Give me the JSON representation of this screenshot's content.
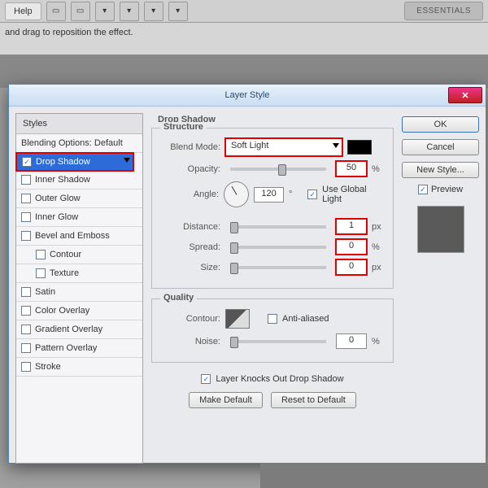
{
  "menubar": {
    "help": "Help"
  },
  "toolbar": {
    "essentials": "ESSENTIALS"
  },
  "optionsbar": {
    "hint": "and drag to reposition the effect."
  },
  "dialog": {
    "title": "Layer Style",
    "styles_header": "Styles",
    "styles": {
      "blending": "Blending Options: Default",
      "drop_shadow": "Drop Shadow",
      "inner_shadow": "Inner Shadow",
      "outer_glow": "Outer Glow",
      "inner_glow": "Inner Glow",
      "bevel": "Bevel and Emboss",
      "contour": "Contour",
      "texture": "Texture",
      "satin": "Satin",
      "color_overlay": "Color Overlay",
      "gradient_overlay": "Gradient Overlay",
      "pattern_overlay": "Pattern Overlay",
      "stroke": "Stroke"
    },
    "panel_title": "Drop Shadow",
    "structure_title": "Structure",
    "quality_title": "Quality",
    "labels": {
      "blend_mode": "Blend Mode:",
      "opacity": "Opacity:",
      "angle": "Angle:",
      "distance": "Distance:",
      "spread": "Spread:",
      "size": "Size:",
      "contour": "Contour:",
      "noise": "Noise:",
      "anti": "Anti-aliased",
      "gl": "Use Global Light",
      "knock": "Layer Knocks Out Drop Shadow"
    },
    "values": {
      "blend_mode": "Soft Light",
      "opacity": "50",
      "angle": "120",
      "distance": "1",
      "spread": "0",
      "size": "0",
      "noise": "0"
    },
    "units": {
      "pct": "%",
      "deg": "°",
      "px": "px"
    },
    "buttons": {
      "make_default": "Make Default",
      "reset_default": "Reset to Default",
      "ok": "OK",
      "cancel": "Cancel",
      "new_style": "New Style...",
      "preview": "Preview"
    }
  }
}
